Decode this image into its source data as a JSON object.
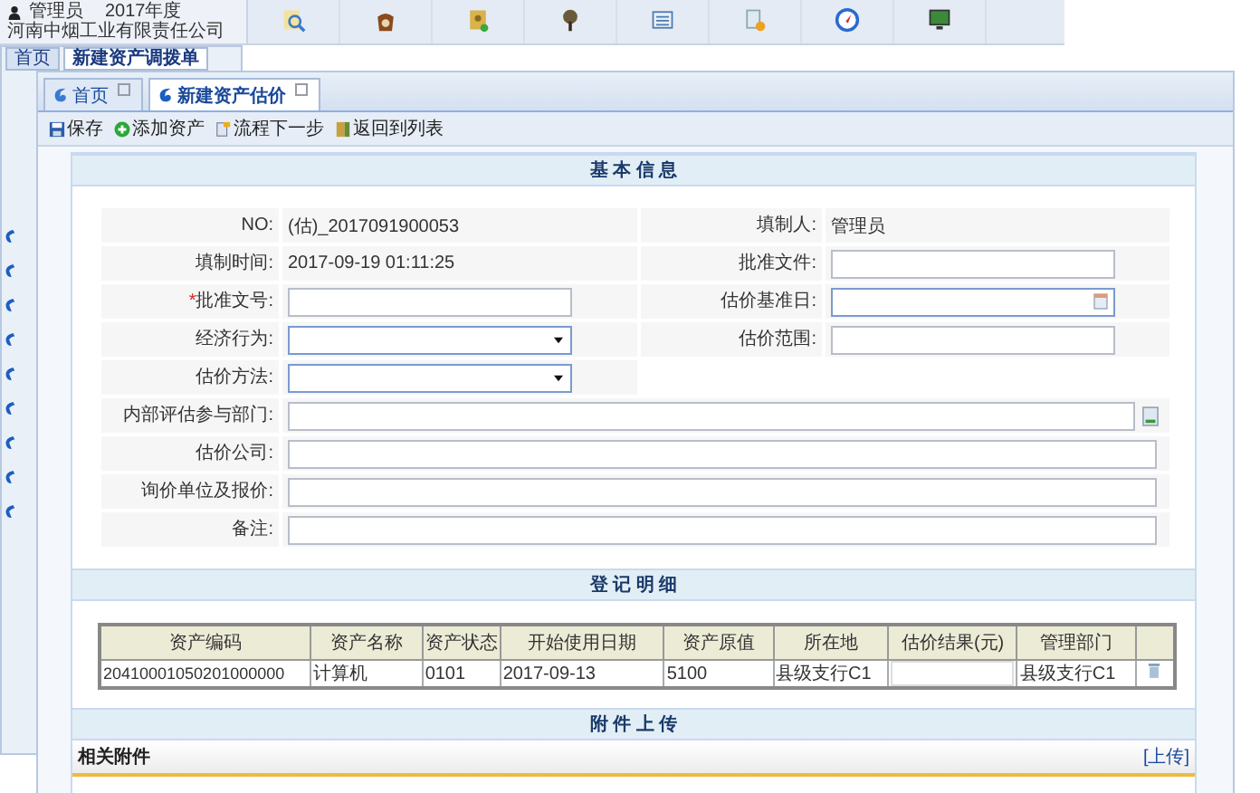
{
  "background": {
    "user": "管理员",
    "year": "2017年度",
    "company": "河南中烟工业有限责任公司",
    "tabs": [
      {
        "label": "首页",
        "selected": false
      },
      {
        "label": "新建资产调拨单",
        "selected": true
      }
    ],
    "toolbar": [
      {
        "kind": "search"
      },
      {
        "kind": "bag"
      },
      {
        "kind": "safe"
      },
      {
        "kind": "tree"
      },
      {
        "kind": "list"
      },
      {
        "kind": "doc"
      },
      {
        "kind": "compass"
      },
      {
        "kind": "monitor"
      }
    ]
  },
  "tabs": [
    {
      "label": "首页",
      "selected": false
    },
    {
      "label": "新建资产估价",
      "selected": true
    }
  ],
  "toolbar": [
    {
      "label": "保存",
      "kind": "save"
    },
    {
      "label": "添加资产",
      "kind": "add"
    },
    {
      "label": "流程下一步",
      "kind": "next"
    },
    {
      "label": "返回到列表",
      "kind": "back"
    }
  ],
  "basic_info": {
    "title": "基 本 信 息",
    "rows": [
      [
        {
          "label": "NO:",
          "kind": "text",
          "value": "(估)_2017091900053"
        },
        {
          "label": "填制人:",
          "kind": "text",
          "value": "管理员"
        }
      ],
      [
        {
          "label": "填制时间:",
          "kind": "text",
          "value": "2017-09-19 01:11:25"
        },
        {
          "label": "批准文件:",
          "kind": "input"
        }
      ],
      [
        {
          "label": "批准文号:",
          "mark": "*",
          "kind": "input"
        },
        {
          "label": "估价基准日:",
          "kind": "date"
        }
      ],
      [
        {
          "label": "经济行为:",
          "kind": "select"
        },
        {
          "label": "估价范围:",
          "kind": "input"
        }
      ],
      [
        {
          "label": "估价方法:",
          "kind": "select"
        }
      ],
      [
        {
          "label": "内部评估参与部门:",
          "kind": "picker",
          "full": true
        }
      ],
      [
        {
          "label": "估价公司:",
          "kind": "input",
          "full": true
        }
      ],
      [
        {
          "label": "询价单位及报价:",
          "kind": "input",
          "full": true
        }
      ],
      [
        {
          "label": "备注:",
          "kind": "input",
          "full": true
        }
      ]
    ]
  },
  "details": {
    "title": "登 记 明 细",
    "table": {
      "columns": [
        "资产编码",
        "资产名称",
        "资产状态",
        "开始使用日期",
        "资产原值",
        "所在地",
        "估价结果(元)",
        "管理部门"
      ],
      "rows": [
        [
          "20410001050201000000",
          "计算机",
          "0101",
          "2017-09-13",
          "5100",
          "县级支行C1",
          "",
          "县级支行C1"
        ]
      ]
    }
  },
  "attachments": {
    "title": "附 件 上 传",
    "label": "相关附件",
    "upload": "[上传]"
  }
}
